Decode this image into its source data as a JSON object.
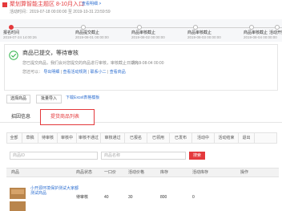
{
  "header": {
    "title": "聚划算智能主题区 8-10月入口",
    "edit_link": "查看明细 >",
    "time_range": "活动时间：2019-07-18 00:00:00 至 2019-10-31 23:59:59"
  },
  "progress": {
    "steps": [
      {
        "label": "报名时间",
        "time": "2019-07-24 14:00:26",
        "active": true
      },
      {
        "label": "商品提交截止",
        "time": "2019-08-01 00:00:00",
        "active": false
      },
      {
        "label": "商品审核截止",
        "time": "2019-08-02 00:00:00",
        "active": false
      },
      {
        "label": "商品审核截止",
        "time": "2019-08-03 00:00:00",
        "active": false
      },
      {
        "label": "商品审核截止",
        "time": "2019-08-04 00:00:00",
        "active": false
      },
      {
        "label": "活动开始",
        "time": "",
        "active": false
      }
    ]
  },
  "status": {
    "title": "商品已提交，等待审核",
    "desc": "您已提交商品，我们会对您提交的商品进行审核，审核截止日期为：",
    "time": "2019-08-04 00:00",
    "follow_label": "您还可以：",
    "follow_links": [
      "导出明细",
      "查看活动规则",
      "联系小二",
      "查看商品"
    ]
  },
  "buttons": {
    "select": "选择商品",
    "import": "批量导入",
    "download": "下载Excel表格模板",
    "compare": "比价商品"
  },
  "tabs": {
    "info": "招因信息",
    "list": "提货商品列表"
  },
  "filters": [
    "全部",
    "草稿",
    "待审核",
    "审核中",
    "审核不通过",
    "审核通过",
    "已报名",
    "已领用",
    "已发布",
    "活动中",
    "活动结束",
    "退出"
  ],
  "search": {
    "placeholder_1": "商品ID",
    "placeholder_2": "商品名称",
    "button": "搜索"
  },
  "table": {
    "headers": [
      "商品",
      "商品状态",
      "一口价",
      "活动价格",
      "库存",
      "活动库存",
      "操作"
    ],
    "rows": [
      {
        "name": "小开源环境保护测试大家都测试商品",
        "status": "待审核",
        "price": "40",
        "activity_price": "30",
        "stock": "800",
        "activity_stock": "0"
      }
    ]
  },
  "colors": {
    "accent": "#e4393c",
    "link": "#2e6fd1",
    "success": "#31b44b"
  }
}
